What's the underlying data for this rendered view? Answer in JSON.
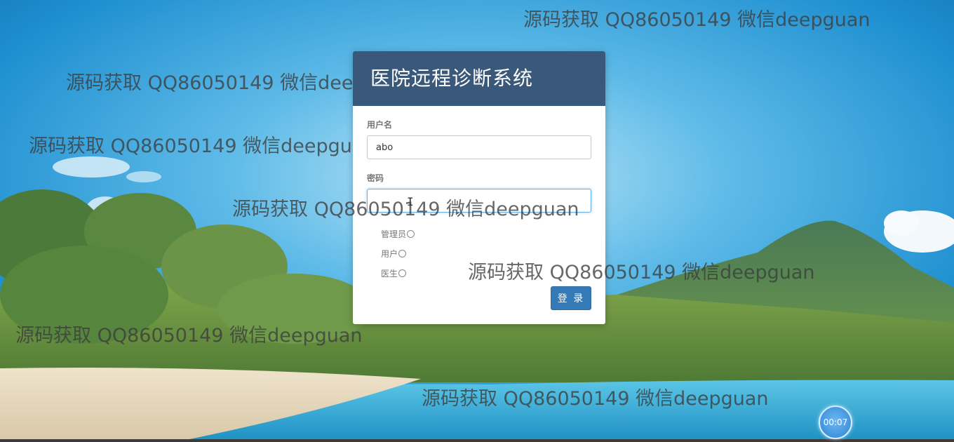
{
  "login": {
    "title": "医院远程诊断系统",
    "username_label": "用户名",
    "username_value": "abo",
    "password_label": "密码",
    "password_value": "",
    "roles": [
      {
        "label": "管理员"
      },
      {
        "label": "用户"
      },
      {
        "label": "医生"
      }
    ],
    "submit_label": "登 录"
  },
  "watermark": {
    "text": "源码获取 QQ86050149 微信deepguan"
  },
  "recorder": {
    "timer": "00:07"
  },
  "colors": {
    "header_bg": "#3a5879",
    "button_bg": "#337ab7",
    "sky": "#3fa3dc"
  }
}
